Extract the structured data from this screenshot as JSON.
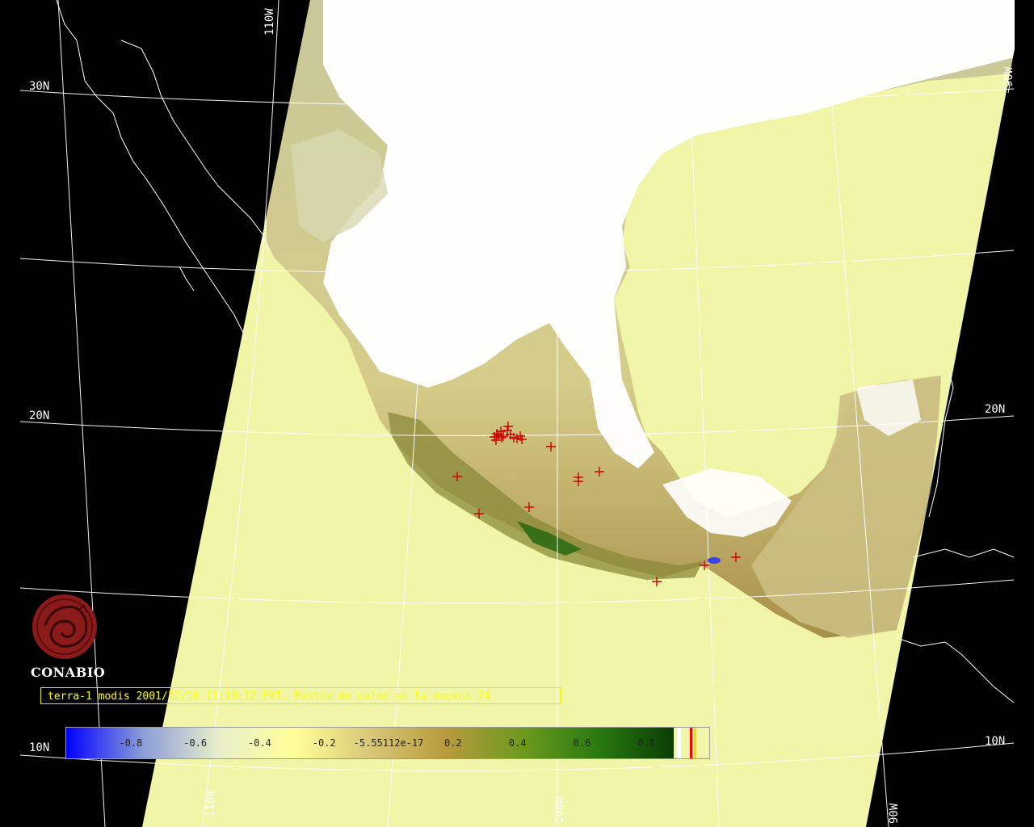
{
  "title_text": "terra-1 modis 2001/12/10 11:10:12 EVI. Puntos de calor en la escena 24",
  "logo": {
    "text": "CONABIO"
  },
  "lat_labels": [
    {
      "name": "lat-label-30n-left",
      "text": "30N"
    },
    {
      "name": "lat-label-20n-left",
      "text": "20N"
    },
    {
      "name": "lat-label-20n-right",
      "text": "20N"
    },
    {
      "name": "lat-label-10n-left",
      "text": "10N"
    },
    {
      "name": "lat-label-10n-right",
      "text": "10N"
    }
  ],
  "lon_labels": [
    {
      "name": "lon-label-110w-top",
      "text": "110W"
    },
    {
      "name": "lon-label-110w-bottom",
      "text": "110W"
    },
    {
      "name": "lon-label-100w-bottom",
      "text": "100W"
    },
    {
      "name": "lon-label-90w-bottom",
      "text": "90W"
    },
    {
      "name": "lon-label-90w-right",
      "text": "90W"
    }
  ],
  "legend": {
    "ticks": [
      "-0.8",
      "-0.6",
      "-0.4",
      "-0.2",
      "-5.55112e-17",
      "0.2",
      "0.4",
      "0.6",
      "0.8"
    ],
    "tick_values": [
      -0.8,
      -0.6,
      -0.4,
      -0.2,
      0,
      0.2,
      0.4,
      0.6,
      0.8
    ],
    "range": [
      -1,
      1
    ],
    "gradient_colors": [
      "#0000ff",
      "#8a9cd8",
      "#e8eecc",
      "#ffff99",
      "#d8c878",
      "#b89a3c",
      "#6e9a1e",
      "#2a7a10",
      "#0a3e06"
    ],
    "end_marker_colors": [
      "#ffffff",
      "#ff0000",
      "#ffd700"
    ]
  },
  "hotspot_count": 24,
  "colors": {
    "ocean_swath": "#f0f5a8",
    "cloud": "#ffffff",
    "background": "#000000",
    "coastline": "#ffffff",
    "grid": "#ffffff",
    "hotspot": "#cc0000",
    "title_text": "#ffff00"
  }
}
